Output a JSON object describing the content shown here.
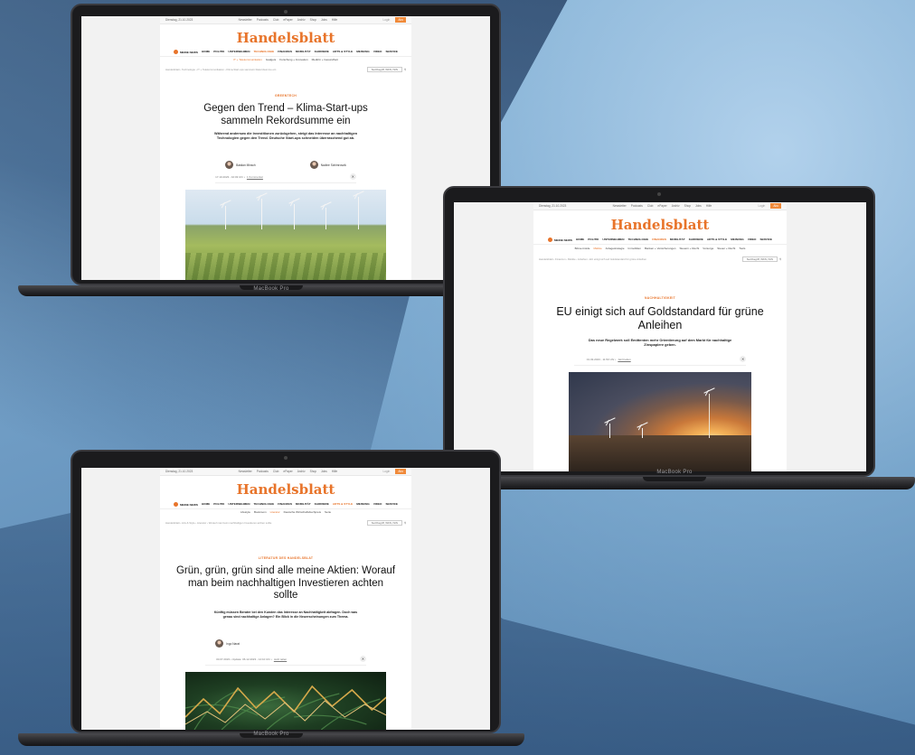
{
  "scene": {
    "brand": "MacBook Pro"
  },
  "site": {
    "logo": "Handelsblatt",
    "mynews": "MEINE NEWS",
    "topbar_links": [
      "Newsletter",
      "Podcasts",
      "Club",
      "ePaper",
      "Archiv",
      "Shop",
      "Jobs",
      "Hilfe"
    ],
    "login": "Login",
    "abo": "Abo",
    "search_placeholder": "Suchbegriff, WKN, ISIN"
  },
  "laptop1": {
    "date": "Dienstag, 21.10.2023",
    "nav": [
      "HOME",
      "POLITIK",
      "UNTERNEHMEN",
      "TECHNOLOGIE",
      "FINANZEN",
      "MOBILITÄT",
      "KARRIERE",
      "ARTS & STYLE",
      "MEINUNG",
      "VIDEO",
      "SERVICE"
    ],
    "nav_active": "TECHNOLOGIE",
    "subnav": [
      "IT + Telekommunikation",
      "Gadgets",
      "Forschung + Innovation",
      "Medizin + Gesundheit"
    ],
    "crumb": "Handelsblatt › Technologie › IT + Telekommunikation › Klima-Start-ups sammeln Rekordsumme ein",
    "kicker": "GREENTECH",
    "headline": "Gegen den Trend – Klima-Start-ups sammeln Rekordsumme ein",
    "teaser": "Während anderswo die Investitionen zurückgehen, steigt das Interesse an nachhaltigen Technologien gegen den Trend. Deutsche Start-ups schneiden überraschend gut ab.",
    "author1": "Bastian Minsch",
    "author2": "Nadine Schimroszik",
    "meta": "17.10.2023 - 10:03 Uhr •",
    "meta_link": "1 Kommentar",
    "share": "✕"
  },
  "laptop2": {
    "date": "Dienstag, 21.10.2023",
    "nav": [
      "HOME",
      "POLITIK",
      "UNTERNEHMEN",
      "TECHNOLOGIE",
      "FINANZEN",
      "MOBILITÄT",
      "KARRIERE",
      "ARTS & STYLE",
      "MEINUNG",
      "VIDEO",
      "SERVICE"
    ],
    "nav_active": "FINANZEN",
    "subnav": [
      "Börse-Inside",
      "Märkte",
      "Anlagestrategie",
      "Immobilien",
      "Banken + Versicherungen",
      "Steuern + Recht",
      "Vorsorge",
      "Steuer + Recht",
      "Tools"
    ],
    "crumb": "Handelsblatt › Finanzen › Märkte › Anleihen › EU einigt sich auf Goldstandard für grüne Anleihen",
    "kicker": "NACHHALTIGKEIT",
    "headline": "EU einigt sich auf Goldstandard für grüne Anleihen",
    "teaser": "Das neue Regelwerk soll Emittenten mehr Orientierung auf dem Markt für nachhaltige Zinspapiere geben.",
    "meta": "01.03.2023 - 11:50 Uhr •",
    "meta_link": "Jetzt teilen",
    "share": "✕"
  },
  "laptop3": {
    "date": "Dienstag, 21.10.2023",
    "nav": [
      "HOME",
      "POLITIK",
      "UNTERNEHMEN",
      "TECHNOLOGIE",
      "FINANZEN",
      "MOBILITÄT",
      "KARRIERE",
      "ARTS & STYLE",
      "MEINUNG",
      "VIDEO",
      "SERVICE"
    ],
    "nav_active": "ARTS & STYLE",
    "subnav": [
      "Lifestyle",
      "Bookroom",
      "Literatur",
      "Deutsche Wirtschaftsbuchpreis",
      "Serie"
    ],
    "subnav_active": "Literatur",
    "crumb": "Handelsblatt › Arts & Style › Literatur › Worauf man beim nachhaltigen Investieren achten sollte",
    "kicker": "LITERATUR DES HANDELSBLAT",
    "headline": "Grün, grün, grün sind alle meine Aktien: Worauf man beim nachhaltigen Investieren achten sollte",
    "teaser": "Künftig müssen Berater bei den Kunden das Interesse an Nachhaltigkeit abfragen. Doch was genau sind nachhaltige Anlagen? Ein Blick in die Neuerscheinungen zum Thema.",
    "author1": "Ingo Narat",
    "meta": "30.07.2023 • Update: 06.12.2023 - 14:10 Uhr •",
    "meta_link": "Jetzt teilen",
    "share": "✕"
  }
}
